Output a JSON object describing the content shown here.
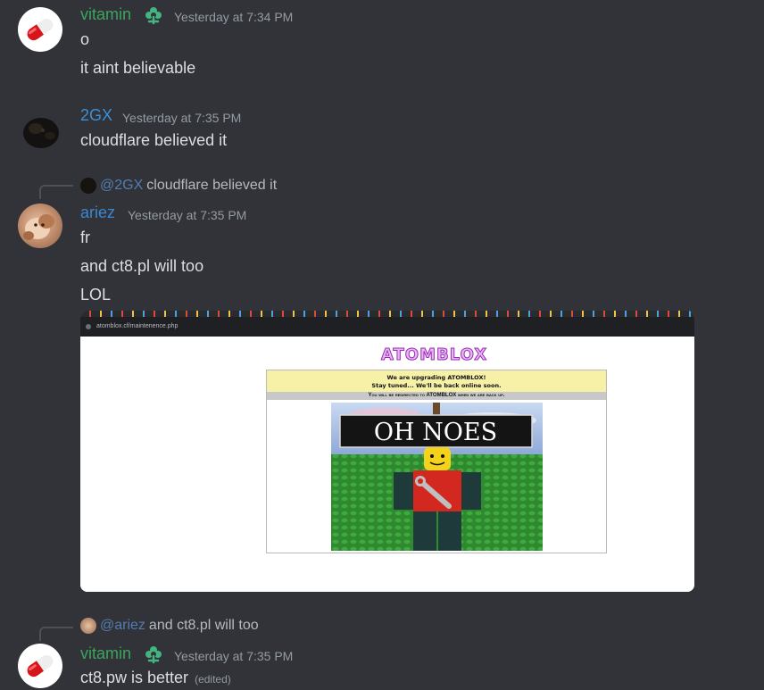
{
  "colors": {
    "background": "#313338",
    "username_vitamin": "#3ba55d",
    "username_2gx": "#3d8fd6",
    "username_ariez": "#3a87d0",
    "timestamp": "#949ba4",
    "text": "#dbdee1"
  },
  "messages": [
    {
      "author": "vitamin",
      "role_icon": "flower-icon",
      "timestamp": "Yesterday at 7:34 PM",
      "lines": [
        "o",
        "it aint believable"
      ]
    },
    {
      "author": "2GX",
      "timestamp": "Yesterday at 7:35 PM",
      "lines": [
        "cloudflare believed it"
      ]
    },
    {
      "reply": {
        "mention": "@2GX",
        "text": "cloudflare believed it"
      },
      "author": "ariez",
      "timestamp": "Yesterday at 7:35 PM",
      "lines": [
        "fr",
        "and ct8.pl will too",
        "LOL"
      ],
      "attachment": {
        "url_bar": "atomblox.cf/maintenence.php",
        "logo": "ATOMBLOX",
        "notice_line1": "We are upgrading ATOMBLOX!",
        "notice_line2": "Stay tuned... We'll be back online soon.",
        "redirect_notice": "You will be redirected to ATOMBLOX when we are back up.",
        "sign_text": "OH NOES"
      }
    },
    {
      "reply": {
        "mention": "@ariez",
        "text": "and ct8.pl will too"
      },
      "author": "vitamin",
      "role_icon": "flower-icon",
      "timestamp": "Yesterday at 7:35 PM",
      "lines": [
        "ct8.pw is better"
      ],
      "edited": "(edited)"
    }
  ]
}
